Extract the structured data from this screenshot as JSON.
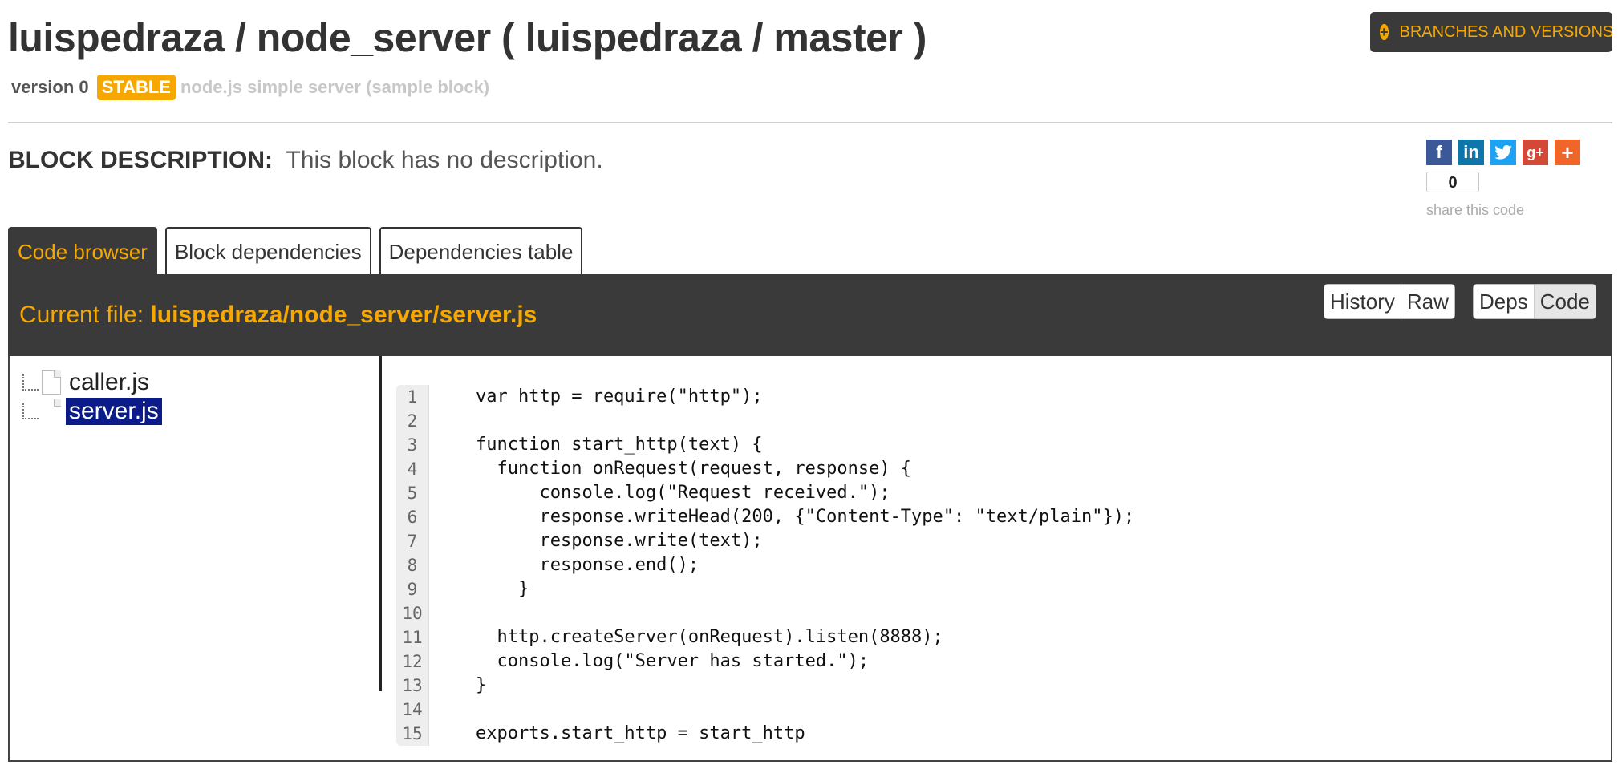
{
  "header": {
    "title": "luispedraza / node_server ( luispedraza / master )",
    "version": "version 0",
    "badge": "STABLE",
    "block_name": "node.js simple server (sample block)",
    "branches_button": "BRANCHES AND VERSIONS"
  },
  "description": {
    "label": "BLOCK DESCRIPTION:",
    "text": "This block has no description."
  },
  "share": {
    "count": "0",
    "label": "share this code",
    "icons": [
      "facebook-icon",
      "linkedin-icon",
      "twitter-icon",
      "googleplus-icon",
      "addthis-icon"
    ]
  },
  "tabs": [
    {
      "label": "Code browser",
      "active": true
    },
    {
      "label": "Block dependencies",
      "active": false
    },
    {
      "label": "Dependencies table",
      "active": false
    }
  ],
  "current_file": {
    "label": "Current file:",
    "path": "luispedraza/node_server/server.js"
  },
  "toolbar": {
    "history": "History",
    "raw": "Raw",
    "deps": "Deps",
    "code": "Code"
  },
  "files": [
    {
      "name": "caller.js",
      "selected": false
    },
    {
      "name": "server.js",
      "selected": true
    }
  ],
  "code": {
    "lines": [
      "var http = require(\"http\");",
      "",
      "function start_http(text) {",
      "  function onRequest(request, response) {",
      "      console.log(\"Request received.\");",
      "      response.writeHead(200, {\"Content-Type\": \"text/plain\"});",
      "      response.write(text);",
      "      response.end();",
      "    }",
      "",
      "  http.createServer(onRequest).listen(8888);",
      "  console.log(\"Server has started.\");",
      "}",
      "",
      "exports.start_http = start_http"
    ]
  },
  "colors": {
    "accent": "#f6a800",
    "dark_bar": "#3a3a3a",
    "selected_file": "#0b1b8a"
  }
}
